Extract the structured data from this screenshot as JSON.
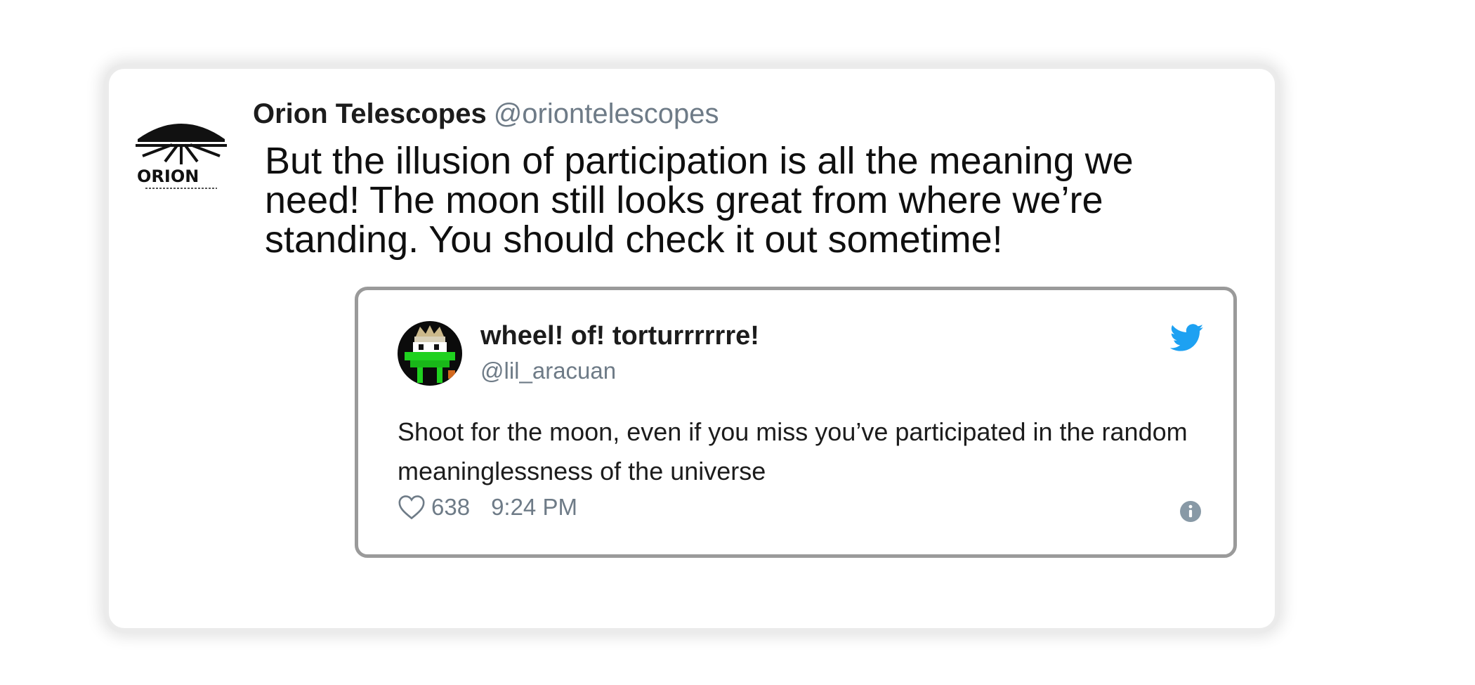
{
  "tweet": {
    "author_name": "Orion Telescopes",
    "author_handle": "@oriontelescopes",
    "avatar_icon": "orion-logo-icon",
    "avatar_text": "ORION",
    "text": "But the illusion of participation is all the meaning we need! The moon still looks great from where we’re standing. You should check it out sometime!"
  },
  "quoted_tweet": {
    "author_name": "wheel! of! torturrrrrre!",
    "author_handle": "@lil_aracuan",
    "avatar_icon": "pixel-frog-avatar-icon",
    "text": "Shoot for the moon, even if you miss you’ve participated in the random meaninglessness of the universe",
    "likes": "638",
    "time": "9:24 PM",
    "brand_icon": "twitter-bird-icon",
    "brand_color": "#1da1f2",
    "info_icon": "info-icon"
  }
}
